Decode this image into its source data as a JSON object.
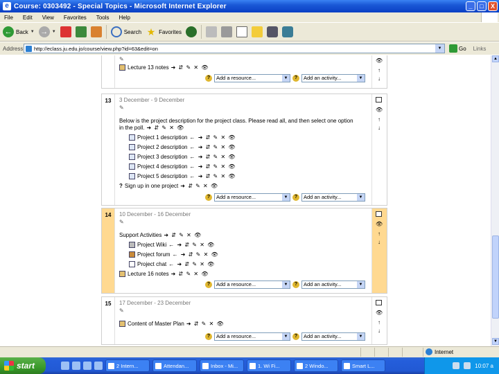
{
  "window": {
    "title": "Course: 0303492 - Special Topics - Microsoft Internet Explorer",
    "controls": [
      "_",
      "□",
      "X"
    ]
  },
  "menu": [
    "File",
    "Edit",
    "View",
    "Favorites",
    "Tools",
    "Help"
  ],
  "toolbar": {
    "back": "Back",
    "search": "Search",
    "favorites": "Favorites"
  },
  "address": {
    "label": "Address",
    "url": "http://eclass.ju.edu.jo/course/view.php?id=63&edit=on",
    "go": "Go",
    "links": "Links"
  },
  "sections": [
    {
      "number": "",
      "items": [
        {
          "label": "Lecture 13 notes",
          "icon": "lesson",
          "edit": "➜ ⇵ ✎ ✕ 👁"
        }
      ],
      "add_resource": "Add a resource...",
      "add_activity": "Add an activity..."
    },
    {
      "number": "13",
      "date": "3 December - 9 December",
      "summary_line1": "Below is the project description for the project class. Please read all, and then select one option",
      "summary_line2": "in the poll.",
      "summary_edit": "➜ ⇵ ✎ ✕ 👁",
      "items": [
        {
          "label": "Project 1 description",
          "icon": "doc",
          "edit": "← ➜ ⇵ ✎ ✕ 👁"
        },
        {
          "label": "Project 2 description",
          "icon": "doc",
          "edit": "← ➜ ⇵ ✎ ✕ 👁"
        },
        {
          "label": "Project 3 description",
          "icon": "doc",
          "edit": "← ➜ ⇵ ✎ ✕ 👁"
        },
        {
          "label": "Project 4 description",
          "icon": "doc",
          "edit": "← ➜ ⇵ ✎ ✕ 👁"
        },
        {
          "label": "Project 5 description",
          "icon": "doc",
          "edit": "← ➜ ⇵ ✎ ✕ 👁"
        },
        {
          "label": "Sign up in one project",
          "icon": "choice",
          "edit": "➜ ⇵ ✎ ✕ 👁"
        }
      ],
      "add_resource": "Add a resource...",
      "add_activity": "Add an activity..."
    },
    {
      "number": "14",
      "date": "10 December - 16 December",
      "summary_line1": "Support Activities",
      "summary_edit": "➜ ⇵ ✎ ✕ 👁",
      "items": [
        {
          "label": "Project Wiki",
          "icon": "wiki",
          "edit": "← ➜ ⇵ ✎ ✕ 👁"
        },
        {
          "label": "Project forum",
          "icon": "forum",
          "edit": "← ➜ ⇵ ✎ ✕ 👁"
        },
        {
          "label": "Project chat",
          "icon": "chat",
          "edit": "← ➜ ⇵ ✎ ✕ 👁"
        },
        {
          "label": "Lecture 16 notes",
          "icon": "lesson",
          "edit": "➜ ⇵ ✎ ✕ 👁"
        }
      ],
      "add_resource": "Add a resource...",
      "add_activity": "Add an activity..."
    },
    {
      "number": "15",
      "date": "17 December - 23 December",
      "items": [
        {
          "label": "Content of Master Plan",
          "icon": "lesson",
          "edit": "➜ ⇵ ✎ ✕ 👁"
        }
      ],
      "add_resource": "Add a resource...",
      "add_activity": "Add an activity..."
    }
  ],
  "status": {
    "zone": "Internet"
  },
  "taskbar": {
    "start": "start",
    "tasks": [
      "2 Intern...",
      "Attendan...",
      "Inbox - Mi...",
      "1. Wi Fi...",
      "2 Windo...",
      "Smart L..."
    ],
    "clock": "10:07 a"
  }
}
